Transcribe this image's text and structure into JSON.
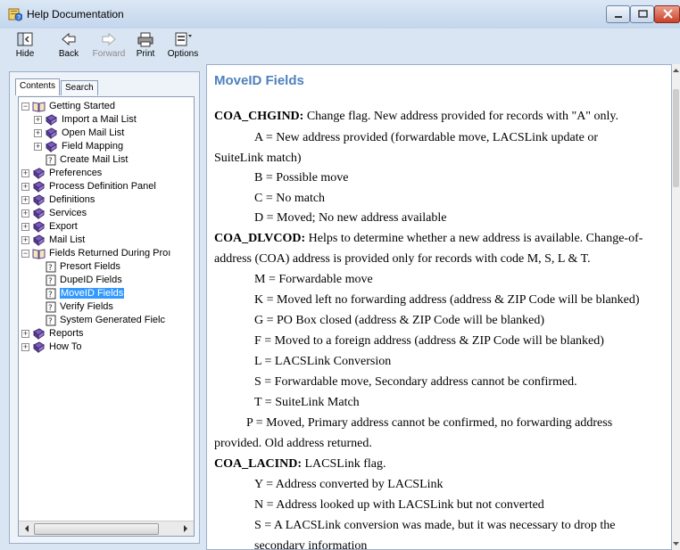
{
  "window": {
    "title": "Help Documentation"
  },
  "toolbar": {
    "hide": "Hide",
    "back": "Back",
    "forward": "Forward",
    "print": "Print",
    "options": "Options"
  },
  "tabs": {
    "contents": "Contents",
    "search": "Search"
  },
  "tree": {
    "getting_started": "Getting Started",
    "import_mail_list": "Import a Mail List",
    "open_mail_list": "Open Mail List",
    "field_mapping": "Field Mapping",
    "create_mail_list": "Create Mail List",
    "preferences": "Preferences",
    "process_definition_panel": "Process Definition Panel",
    "definitions": "Definitions",
    "services": "Services",
    "export": "Export",
    "mail_list": "Mail List",
    "fields_returned": "Fields Returned During Proı",
    "presort_fields": "Presort Fields",
    "dupeid_fields": "DupeID Fields",
    "moveid_fields": "MoveID Fields",
    "verify_fields": "Verify Fields",
    "system_generated": "System Generated Fielc",
    "reports": "Reports",
    "how_to": "How To"
  },
  "content": {
    "heading": "MoveID Fields",
    "chgind_name": "COA_CHGIND:",
    "chgind_desc": " Change flag.  New address provided for records with \"A\" only.",
    "chgind_a1": "A = New address provided (forwardable move, LACSLink update or",
    "chgind_a2": "SuiteLink match)",
    "chgind_b": "B = Possible move",
    "chgind_c": "C = No match",
    "chgind_d": "D = Moved; No new address available",
    "dlvcod_name": "COA_DLVCOD:",
    "dlvcod_desc": " Helps to determine whether a new address is available.  Change-of-",
    "dlvcod_desc2": "address (COA) address is provided only for records with code M, S, L & T.",
    "dlvcod_m": "M = Forwardable move",
    "dlvcod_k": "K = Moved left no forwarding address (address & ZIP Code will be blanked)",
    "dlvcod_g": "G = PO Box closed (address & ZIP Code will be blanked)",
    "dlvcod_f": "F = Moved to a foreign address (address & ZIP Code will be blanked)",
    "dlvcod_l": "L = LACSLink Conversion",
    "dlvcod_s": "S = Forwardable move, Secondary address cannot be confirmed.",
    "dlvcod_t": "T = SuiteLink Match",
    "dlvcod_p1": "P = Moved, Primary address cannot be confirmed, no forwarding address",
    "dlvcod_p2": "provided.  Old address returned.",
    "lacind_name": "COA_LACIND:",
    "lacind_desc": " LACSLink flag.",
    "lacind_y": "Y = Address converted by LACSLink",
    "lacind_n": "N = Address looked up with LACSLink but not converted",
    "lacind_s": "S = A LACSLink conversion was made, but it was necessary to drop the",
    "lacind_s2": "secondary information"
  },
  "colors": {
    "heading": "#4f81bd",
    "selection": "#3399ff"
  }
}
